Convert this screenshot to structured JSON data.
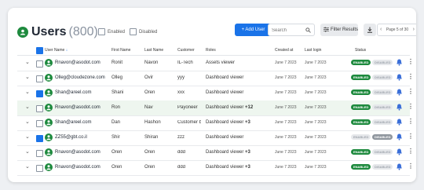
{
  "header": {
    "title": "Users",
    "count": "(800)",
    "filters": [
      {
        "label": "Enabled",
        "checked": false
      },
      {
        "label": "Disabled",
        "checked": false
      }
    ],
    "add_button": "+ Add User",
    "search_placeholder": "Search",
    "filter_button": "Filter Results",
    "pager_label": "Page 5 of 30"
  },
  "columns": {
    "user_name": "User Name",
    "first_name": "First Name",
    "last_name": "Last Name",
    "customer": "Customer",
    "roles": "Roles",
    "created_at": "Created at",
    "last_login": "Last login",
    "status": "Status"
  },
  "status_labels": {
    "enabled": "ENABLED",
    "disabled": "DISABLED"
  },
  "colors": {
    "accent": "#1a73e8",
    "brand_green": "#1e8a3e",
    "highlight_row": "#eef6ef"
  },
  "rows": [
    {
      "email": "Rnavon@asodot.com",
      "first": "Ronit",
      "last": "Navon",
      "customer": "IL-Tech",
      "role": "Assets viewer",
      "role_extra": "",
      "created": "June 7 2023",
      "login": "June 7 2023",
      "enabled": true,
      "checked": false,
      "highlight": false
    },
    {
      "email": "Olleg@cloudezone.com",
      "first": "Olleg",
      "last": "Ovir",
      "customer": "yyy",
      "role": "Dashboard viewer",
      "role_extra": "",
      "created": "June 7 2023",
      "login": "June 7 2023",
      "enabled": true,
      "checked": false,
      "highlight": false
    },
    {
      "email": "Shan@areel.com",
      "first": "Shani",
      "last": "Oren",
      "customer": "xxx",
      "role": "Dashboard viewer",
      "role_extra": "",
      "created": "June 7 2023",
      "login": "June 7 2023",
      "enabled": true,
      "checked": true,
      "highlight": false
    },
    {
      "email": "Rnavon@asodot.com",
      "first": "Ron",
      "last": "Nav",
      "customer": "Payoneer",
      "role": "Dashboard viewer",
      "role_extra": "+12",
      "created": "June 7 2023",
      "login": "June 7 2023",
      "enabled": true,
      "checked": false,
      "highlight": true
    },
    {
      "email": "Shan@areel.com",
      "first": "Dan",
      "last": "Hashon",
      "customer": "Customer b",
      "role": "Dashboard viewer",
      "role_extra": "+3",
      "created": "June 7 2023",
      "login": "June 7 2023",
      "enabled": true,
      "checked": false,
      "highlight": false
    },
    {
      "email": "ZZ55@gbt.co.il",
      "first": "Shir",
      "last": "Shiran",
      "customer": "zzz",
      "role": "Dashboard viewer",
      "role_extra": "",
      "created": "June 7 2023",
      "login": "June 7 2023",
      "enabled": false,
      "checked": true,
      "highlight": false
    },
    {
      "email": "Rnavon@asodot.com",
      "first": "Oren",
      "last": "Oren",
      "customer": "ddd",
      "role": "Dashboard viewer",
      "role_extra": "+3",
      "created": "June 7 2023",
      "login": "June 7 2023",
      "enabled": true,
      "checked": false,
      "highlight": false
    },
    {
      "email": "Rnavon@asodot.com",
      "first": "Oren",
      "last": "Oren",
      "customer": "ddd",
      "role": "Dashboard viewer",
      "role_extra": "+3",
      "created": "June 7 2023",
      "login": "June 7 2023",
      "enabled": true,
      "checked": false,
      "highlight": false
    }
  ]
}
